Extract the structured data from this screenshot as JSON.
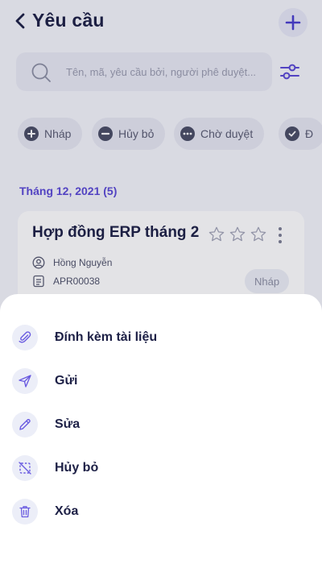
{
  "header": {
    "title": "Yêu cầu"
  },
  "search": {
    "placeholder": "Tên, mã, yêu cầu bởi, người phê duyệt..."
  },
  "filters": [
    {
      "label": "Nháp"
    },
    {
      "label": "Hủy bỏ"
    },
    {
      "label": "Chờ duyệt"
    },
    {
      "label": "Đ"
    }
  ],
  "group": {
    "title": "Tháng 12, 2021 (5)"
  },
  "card": {
    "title": "Hợp đồng ERP tháng 2",
    "requester": "Hồng Nguyễn",
    "code": "APR00038",
    "status": "Nháp",
    "rating": 0,
    "rating_max": 3
  },
  "sheet": {
    "actions": [
      {
        "label": "Đính kèm tài liệu",
        "icon": "paperclip-icon"
      },
      {
        "label": "Gửi",
        "icon": "send-icon"
      },
      {
        "label": "Sửa",
        "icon": "pencil-icon"
      },
      {
        "label": "Hủy bỏ",
        "icon": "cancel-icon"
      },
      {
        "label": "Xóa",
        "icon": "trash-icon"
      }
    ]
  },
  "colors": {
    "accent": "#5b49d6",
    "icon": "#6a5be0",
    "text": "#1d2046"
  }
}
